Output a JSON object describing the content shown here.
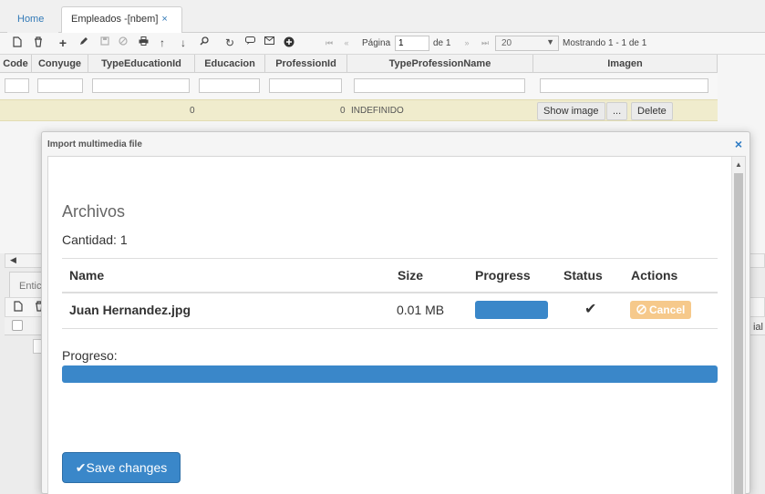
{
  "tabs": {
    "home": "Home",
    "active": "Empleados -[nbem]",
    "close_glyph": "×"
  },
  "toolbar": {
    "icons": [
      "new-icon",
      "delete-icon",
      "add-icon",
      "edit-icon",
      "save-icon",
      "cancel-icon",
      "print-icon",
      "upload-icon",
      "download-icon",
      "search-icon",
      "refresh-icon",
      "comment-icon",
      "email-icon",
      "plus-circle-icon"
    ],
    "page_label": "Página",
    "page_value": "1",
    "page_of": "de 1",
    "page_size": "20",
    "showing": "Mostrando 1 - 1 de 1"
  },
  "grid": {
    "columns": [
      "Code",
      "Conyuge",
      "TypeEducationId",
      "Educacion",
      "ProfessionId",
      "TypeProfessionName",
      "Imagen"
    ],
    "row": {
      "type_education_id": "0",
      "profession_id": "0",
      "type_profession_name": "INDEFINIDO"
    },
    "buttons": {
      "show_image": "Show image",
      "more": "...",
      "delete": "Delete"
    }
  },
  "lower": {
    "subtab": "Entic",
    "edge_text": "ial"
  },
  "modal": {
    "title": "Import multimedia file",
    "close_glyph": "×",
    "heading": "Archivos",
    "count": "Cantidad: 1",
    "table": {
      "headers": {
        "name": "Name",
        "size": "Size",
        "progress": "Progress",
        "status": "Status",
        "actions": "Actions"
      },
      "rows": [
        {
          "name": "Juan Hernandez.jpg",
          "size": "0.01 MB",
          "progress": 1.0,
          "status_icon": "check-icon",
          "action": "Cancel"
        }
      ]
    },
    "progress_label": "Progreso:",
    "progress": 1.0,
    "save_button": "Save changes"
  },
  "colors": {
    "accent": "#3a87c9",
    "cancel": "#f6c98b",
    "row_highlight": "#f0eccd",
    "link": "#337ab7"
  }
}
